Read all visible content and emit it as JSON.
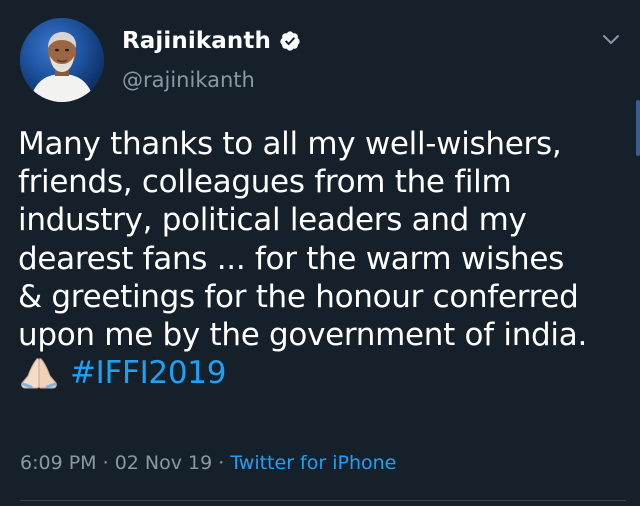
{
  "author": {
    "name": "Rajinikanth",
    "handle": "@rajinikanth",
    "verified": true,
    "avatar": "profile-photo"
  },
  "tweet": {
    "lines": [
      "Many thanks to all my well-wishers,",
      "friends, colleagues from the film",
      "industry, political leaders and my",
      "dearest fans ... for the warm wishes",
      "& greetings for the honour conferred",
      "upon me by the government of india."
    ],
    "emoji": "folded-hands",
    "hashtag": "#IFFI2019"
  },
  "meta": {
    "time": "6:09 PM",
    "separator": " · ",
    "date": "02 Nov 19",
    "source": "Twitter for iPhone"
  },
  "icons": {
    "menu": "chevron-down-icon",
    "verified": "verified-badge-icon"
  },
  "colors": {
    "background": "#15202b",
    "text": "#ffffff",
    "secondary": "#8899a6",
    "accent": "#1da1f2"
  }
}
